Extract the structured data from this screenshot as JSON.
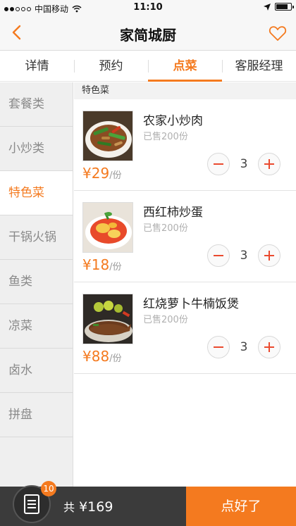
{
  "status_bar": {
    "carrier": "中国移动",
    "time": "11:10"
  },
  "nav": {
    "title": "家简城厨"
  },
  "tabs": [
    "详情",
    "预约",
    "点菜",
    "客服经理"
  ],
  "sidebar": [
    "套餐类",
    "小炒类",
    "特色菜",
    "干锅火锅",
    "鱼类",
    "凉菜",
    "卤水",
    "拼盘"
  ],
  "section_title": "特色菜",
  "dishes": [
    {
      "name": "农家小炒肉",
      "sold": "已售200份",
      "price": "¥29",
      "unit": "/份",
      "qty": "3"
    },
    {
      "name": "西红柿炒蛋",
      "sold": "已售200份",
      "price": "¥18",
      "unit": "/份",
      "qty": "3"
    },
    {
      "name": "红烧萝卜牛楠饭煲",
      "sold": "已售200份",
      "price": "¥88",
      "unit": "/份",
      "qty": "3"
    }
  ],
  "cart": {
    "badge": "10",
    "total_label": "共",
    "total_value": "¥169",
    "submit": "点好了"
  },
  "colors": {
    "accent": "#f47a1f",
    "minus_plus": "#ea4a2f",
    "bottom_bar": "#3b3b3b"
  },
  "icons": [
    "wifi-icon",
    "location-arrow-icon",
    "battery-icon",
    "back-chevron-icon",
    "heart-icon",
    "cart-list-icon",
    "minus-icon",
    "plus-icon"
  ]
}
